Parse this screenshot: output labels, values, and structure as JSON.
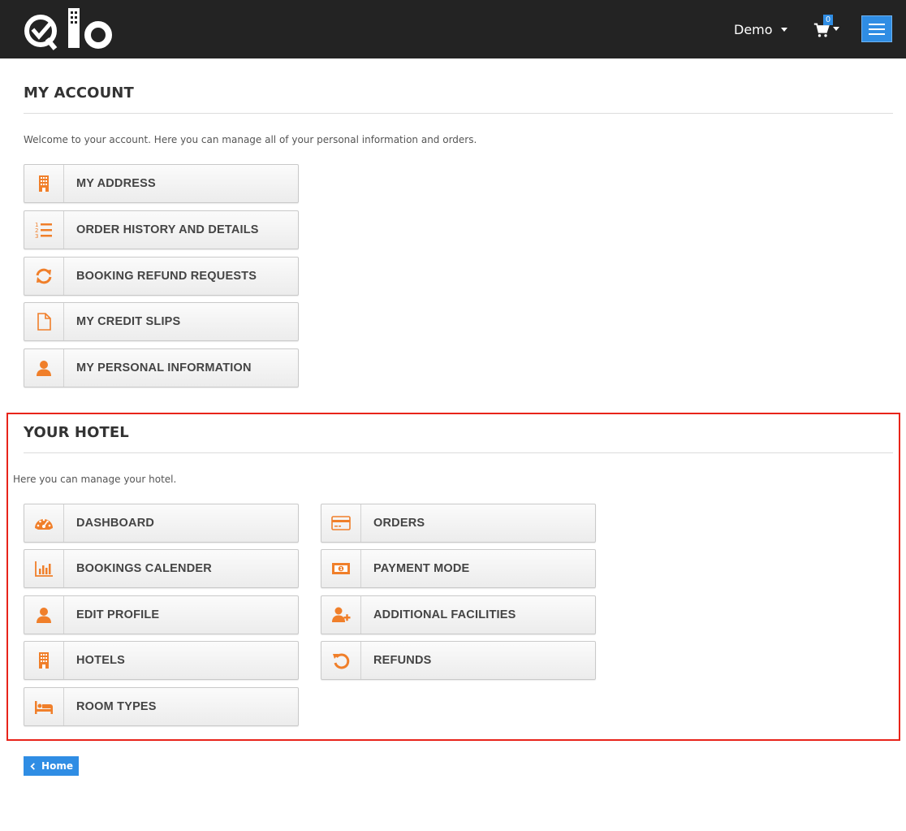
{
  "header": {
    "user_name": "Demo",
    "cart_count": "0",
    "accent": "#2f8de4",
    "bar_color": "#232323"
  },
  "my_account": {
    "title": "MY ACCOUNT",
    "intro": "Welcome to your account. Here you can manage all of your personal information and orders.",
    "items": [
      {
        "label": "MY ADDRESS",
        "icon": "building-icon"
      },
      {
        "label": "ORDER HISTORY AND DETAILS",
        "icon": "ordered-list-icon"
      },
      {
        "label": "BOOKING REFUND REQUESTS",
        "icon": "refresh-icon"
      },
      {
        "label": "MY CREDIT SLIPS",
        "icon": "document-icon"
      },
      {
        "label": "MY PERSONAL INFORMATION",
        "icon": "user-icon"
      }
    ]
  },
  "your_hotel": {
    "title": "YOUR HOTEL",
    "intro": "Here you can manage your hotel.",
    "left_items": [
      {
        "label": "DASHBOARD",
        "icon": "dashboard-icon"
      },
      {
        "label": "BOOKINGS CALENDER",
        "icon": "bar-chart-icon"
      },
      {
        "label": "EDIT PROFILE",
        "icon": "user-icon"
      },
      {
        "label": "HOTELS",
        "icon": "building-icon"
      },
      {
        "label": "ROOM TYPES",
        "icon": "bed-icon"
      }
    ],
    "right_items": [
      {
        "label": "ORDERS",
        "icon": "credit-card-icon"
      },
      {
        "label": "PAYMENT MODE",
        "icon": "money-icon"
      },
      {
        "label": "ADDITIONAL FACILITIES",
        "icon": "user-plus-icon"
      },
      {
        "label": "REFUNDS",
        "icon": "undo-icon"
      }
    ],
    "highlight_color": "#e8241a"
  },
  "footer": {
    "home_label": "Home"
  },
  "icon_color": "#f07f2a"
}
